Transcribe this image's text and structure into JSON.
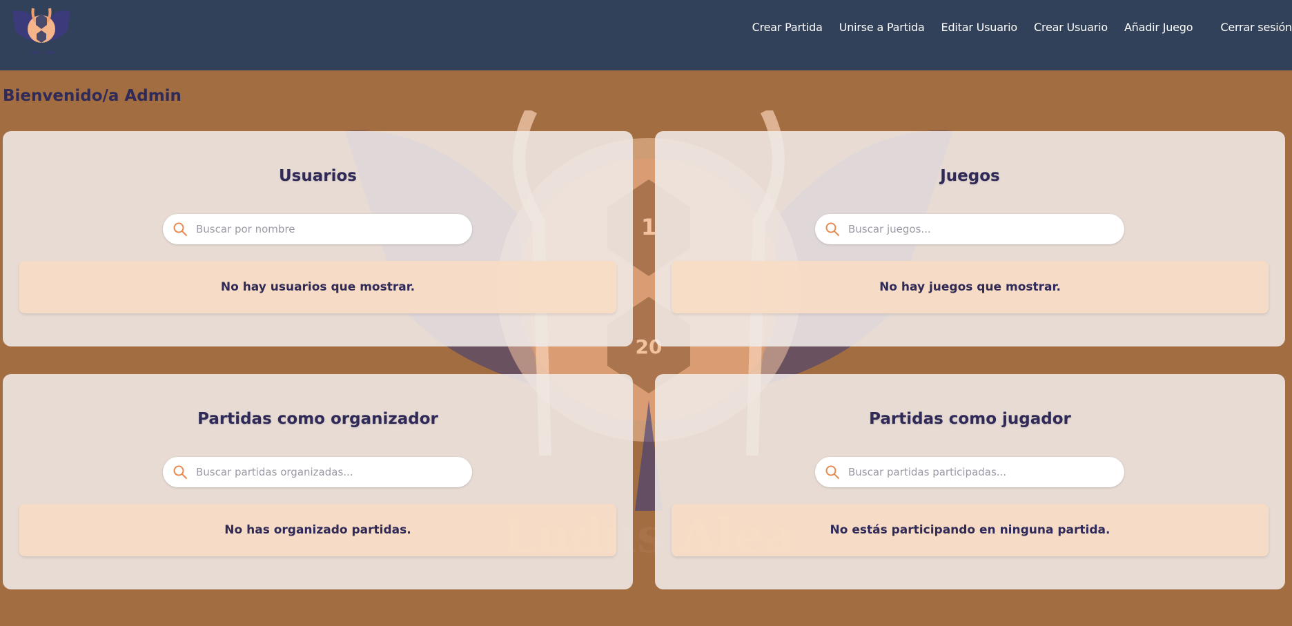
{
  "header": {
    "logo_text": "Ludus Alea",
    "nav": [
      {
        "label": "Crear Partida"
      },
      {
        "label": "Unirse a Partida"
      },
      {
        "label": "Editar Usuario"
      },
      {
        "label": "Crear Usuario"
      },
      {
        "label": "Añadir Juego"
      }
    ],
    "logout_label": "Cerrar sesión"
  },
  "welcome": "Bienvenido/a Admin",
  "watermark": {
    "die_top": "1",
    "die_bottom": "20",
    "text": "Ludus Alea"
  },
  "cards": {
    "users": {
      "title": "Usuarios",
      "placeholder": "Buscar por nombre",
      "empty": "No hay usuarios que mostrar."
    },
    "games": {
      "title": "Juegos",
      "placeholder": "Buscar juegos...",
      "empty": "No hay juegos que mostrar."
    },
    "organizer": {
      "title": "Partidas como organizador",
      "placeholder": "Buscar partidas organizadas...",
      "empty": "No has organizado partidas."
    },
    "player": {
      "title": "Partidas como jugador",
      "placeholder": "Buscar partidas participadas...",
      "empty": "No estás participando en ninguna partida."
    }
  },
  "colors": {
    "navbar": "#32415a",
    "background": "#a26d41",
    "accent": "#e8894f",
    "text_dark": "#2f2a57"
  },
  "icons": {
    "search": "search-icon"
  }
}
